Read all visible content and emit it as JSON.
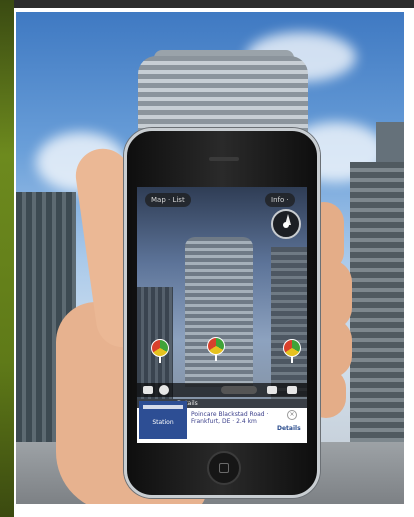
{
  "screen_labels": {
    "left_pill": "Map · List",
    "right_pill": "Info ·",
    "card_header": "Details",
    "card_logo_text": "Station",
    "card_body": "Poincare Blackstad Road · Frankfurt, DE · 2.4 km",
    "card_action": "Details",
    "card_close": "×"
  },
  "poi_markers": [
    {
      "label": "poi-left"
    },
    {
      "label": "poi-center"
    },
    {
      "label": "poi-right"
    }
  ],
  "colors": {
    "accent_green": "#3fa338",
    "accent_yellow": "#e6c21f",
    "accent_red": "#d8412c",
    "card_blue": "#2d4e94"
  }
}
